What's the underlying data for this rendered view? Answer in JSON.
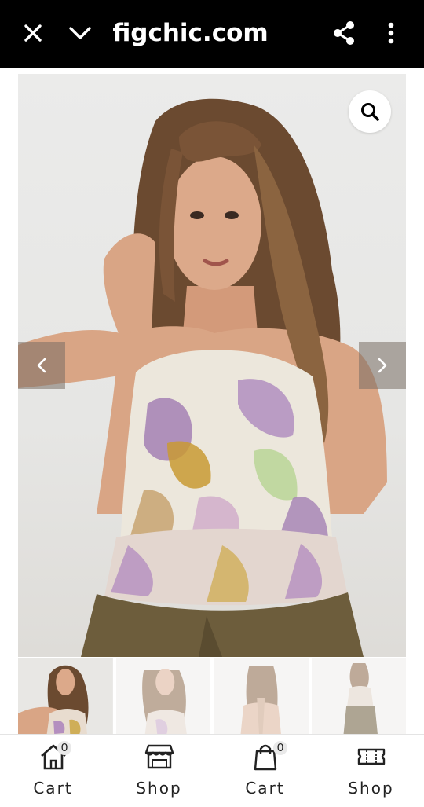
{
  "header": {
    "title": "figchic.com",
    "close_icon": "close-icon",
    "collapse_icon": "chevron-down-icon",
    "share_icon": "share-icon",
    "more_icon": "more-vertical-icon"
  },
  "gallery": {
    "zoom_icon": "search-icon",
    "prev_icon": "chevron-left-icon",
    "next_icon": "chevron-right-icon"
  },
  "nav": {
    "items": [
      {
        "label": "Cart",
        "icon": "home-icon",
        "badge": "0"
      },
      {
        "label": "Shop",
        "icon": "store-icon"
      },
      {
        "label": "Cart",
        "icon": "shopping-bag-icon",
        "badge": "0"
      },
      {
        "label": "Shop",
        "icon": "ticket-icon"
      }
    ]
  },
  "colors": {
    "topbar": "#000000",
    "background": "#ffffff"
  }
}
